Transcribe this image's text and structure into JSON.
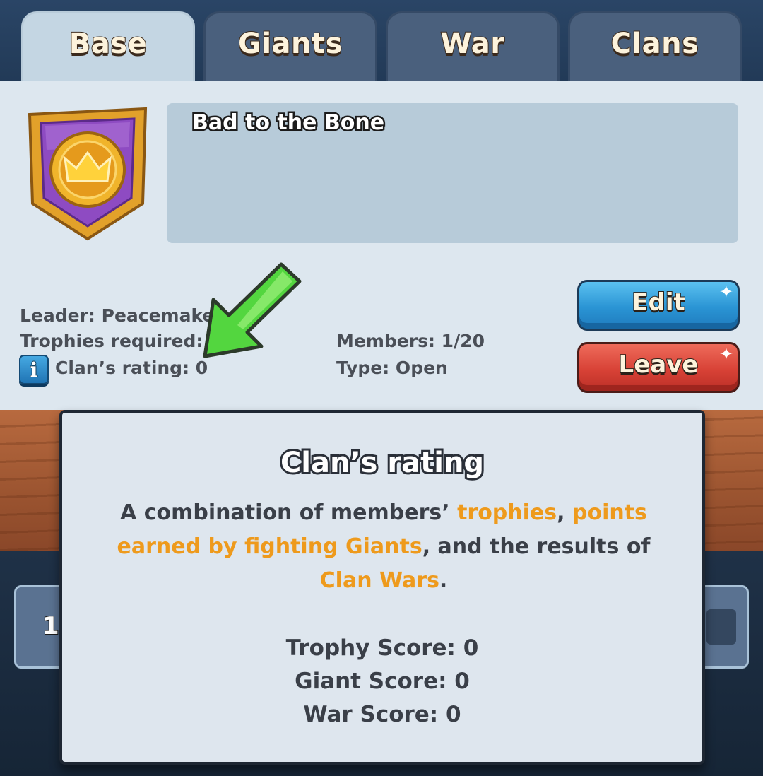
{
  "tabs": [
    {
      "label": "Base",
      "active": true
    },
    {
      "label": "Giants",
      "active": false
    },
    {
      "label": "War",
      "active": false
    },
    {
      "label": "Clans",
      "active": false
    }
  ],
  "clan": {
    "name": "Bad to the Bone",
    "leader": "Leader: Peacemake",
    "trophies_required": "Trophies required:",
    "rating": "Clan’s rating: 0",
    "members": "Members: 1/20",
    "type": "Type: Open",
    "badge_icon": "crown-shield-icon"
  },
  "buttons": {
    "edit": "Edit",
    "leave": "Leave",
    "info": "i"
  },
  "background": {
    "card_number": "1"
  },
  "popup": {
    "title": "Clan’s rating",
    "body": {
      "p1": "A combination of members’ ",
      "h1": "trophies",
      "p2": ", ",
      "h2": "points earned by fighting Giants",
      "p3": ", and the results of ",
      "h3": "Clan Wars",
      "p4": "."
    },
    "scores": [
      "Trophy Score: 0",
      "Giant Score: 0",
      "War Score: 0"
    ]
  },
  "colors": {
    "highlight": "#ee9a1c",
    "edit_button": "#2a94d4",
    "leave_button": "#d84236",
    "arrow": "#4fd13c"
  }
}
